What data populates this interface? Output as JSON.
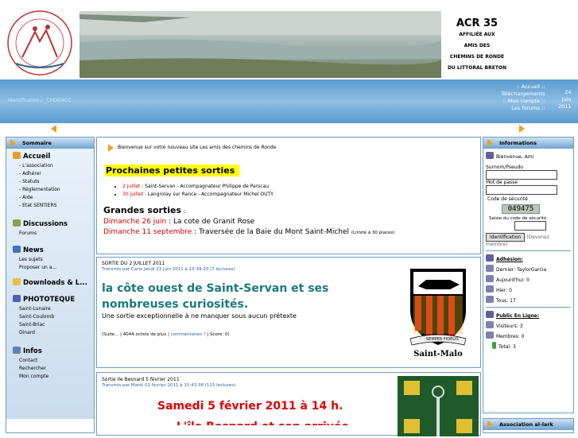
{
  "header": {
    "acr_title": "ACR 35",
    "acr_lines": [
      "AFFILIÉE AUX",
      "AMIS DES",
      "CHEMINS DE RONDE",
      "DU LITTORAL BRETON"
    ]
  },
  "topbar": {
    "identification": "Identification / _CREATACC",
    "links": [
      ":: Accueil ::",
      "Téléchargements",
      ":: Mon compte ::",
      "Les forums ::"
    ],
    "date": [
      "24",
      "Juin",
      "2011"
    ]
  },
  "left_sidebar": {
    "title": "Sommaire",
    "sections": [
      {
        "heading": "Accueil",
        "icon": "house-icon",
        "items": [
          "- L'association",
          "- Adhérer",
          "- Statuts",
          "- Réglementation",
          "- Aide",
          "- Etat SENTIERS"
        ]
      },
      {
        "heading": "Discussions",
        "icon": "discussions-icon",
        "items": [
          "Forums"
        ]
      },
      {
        "heading": "News",
        "icon": "news-icon",
        "items": [
          "Les sujets",
          "Proposer un a..."
        ]
      },
      {
        "heading": "Downloads & L...",
        "icon": "downloads-icon",
        "items": []
      },
      {
        "heading": "PHOTOTEQUE",
        "icon": "photo-icon",
        "items": [
          "Saint-Lunaire",
          "Saint-Coulomb",
          "Saint-Briac",
          "Dinard"
        ]
      },
      {
        "heading": "Infos",
        "icon": "info-icon",
        "items": [
          "Contact",
          "Rechercher",
          "Mon compte"
        ]
      }
    ]
  },
  "welcome": {
    "text": "Bienvenue sur votre nouveau site Les amis des chemins de Ronde",
    "petites_title": "Prochaines petites sorties",
    "petites": [
      {
        "date": "2 juillet",
        "text": " : Saint-Servan - Accompagnateur Philippe de Parscau"
      },
      {
        "date": "30 juillet",
        "text": " : Langrolay sur Rance - Accompagnateur Michel OUTY"
      }
    ],
    "grandes_title": "Grandes sorties",
    "grandes_colon": " :",
    "grandes": [
      {
        "date": "Dimanche 26 juin",
        "text": " : La cote de Granit Rose",
        "note": ""
      },
      {
        "date": "Dimanche 11 septembre",
        "text": " : Traversée de la Baie du Mont Saint-Michel",
        "note": "(Limité à 30 places)"
      }
    ]
  },
  "articles": [
    {
      "title": "SORTIE DU 2 JUILLET 2011",
      "meta": "Transmis par Carlo Jeudi 23 juin 2011 à 15:39:20 (7 lectures)",
      "headline": "la côte ouest de Saint-Servan et ses nombreuses curiosités.",
      "body": "Une sortie exceptionnelle à ne manquer sous aucun prétexte",
      "footer_pre": "(Suite... | 4044 octets de plus | ",
      "footer_link": "commentaires ?",
      "footer_post": " | Score: 0)",
      "crest_caption": "Saint-Malo",
      "motto": "SEMPER FIDELIS"
    },
    {
      "title": "Sortie Ile Besnard 5 février 2011",
      "meta": "Transmis par Mardi 01 février 2011 à 15:43:38 (115 lectures)",
      "headline": "Samedi 5 février 2011 à 14 h.",
      "headline2": "L'île Besnard et son arrivée"
    }
  ],
  "right_sidebar": {
    "title": "Informations",
    "greeting": "Bienvenue, Ami",
    "login_label": "Surnom/Pseudo",
    "password_label": "Mot de passe",
    "code_label": "Code de sécurité",
    "code_value": "049475",
    "code_input_label": "Saisie du code de sécurité",
    "login_button": "Identification",
    "register_pre": "(Devenez",
    "register_post": "membre)",
    "adhesion_title": "Adhésion:",
    "adhesion": [
      "Dernier: TaylorGarcia",
      "Aujourd'hui: 0",
      "Hier: 0",
      "Tous: 17"
    ],
    "online_title": "Public En Ligne:",
    "online": [
      "Visiteurs: 3",
      "Membres: 0",
      "Total: 3"
    ],
    "assoc_title": "Association al-lark"
  },
  "colors": {
    "accent": "#f0a020",
    "blue": "#6e9dc7",
    "red": "#d00000"
  }
}
